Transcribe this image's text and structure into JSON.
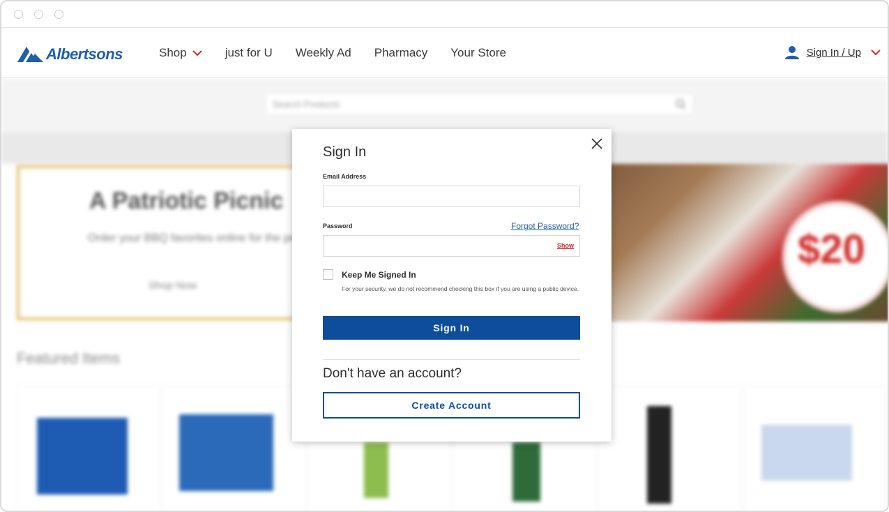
{
  "brand": {
    "name": "Albertsons",
    "color": "#1f5fa8"
  },
  "nav": {
    "items": [
      {
        "label": "Shop",
        "has_dropdown": true
      },
      {
        "label": "just for U"
      },
      {
        "label": "Weekly Ad"
      },
      {
        "label": "Pharmacy"
      },
      {
        "label": "Your Store"
      }
    ]
  },
  "account": {
    "label": "Sign In / Up",
    "icon": "user-icon"
  },
  "background": {
    "search_placeholder": "Search Products",
    "promo_title": "A Patriotic Picnic",
    "promo_body": "Order your BBQ favorites online for the perfect backyard cookout!",
    "promo_link": "Shop Now",
    "promo_badge": "$20",
    "featured_title": "Featured Items"
  },
  "modal": {
    "title": "Sign In",
    "email_label": "Email Address",
    "email_value": "",
    "password_label": "Password",
    "password_value": "",
    "forgot_label": "Forgot Password?",
    "show_label": "Show",
    "keep_signed_in_label": "Keep Me Signed In",
    "keep_signed_in_checked": false,
    "security_note": "For your security, we do not recommend checking this box if you are using a public device.",
    "sign_in_button": "Sign In",
    "no_account_text": "Don't have an account?",
    "create_account_button": "Create Account"
  },
  "colors": {
    "primary": "#0d4d9a",
    "accent_red": "#d12b2b",
    "link": "#2460a7"
  }
}
